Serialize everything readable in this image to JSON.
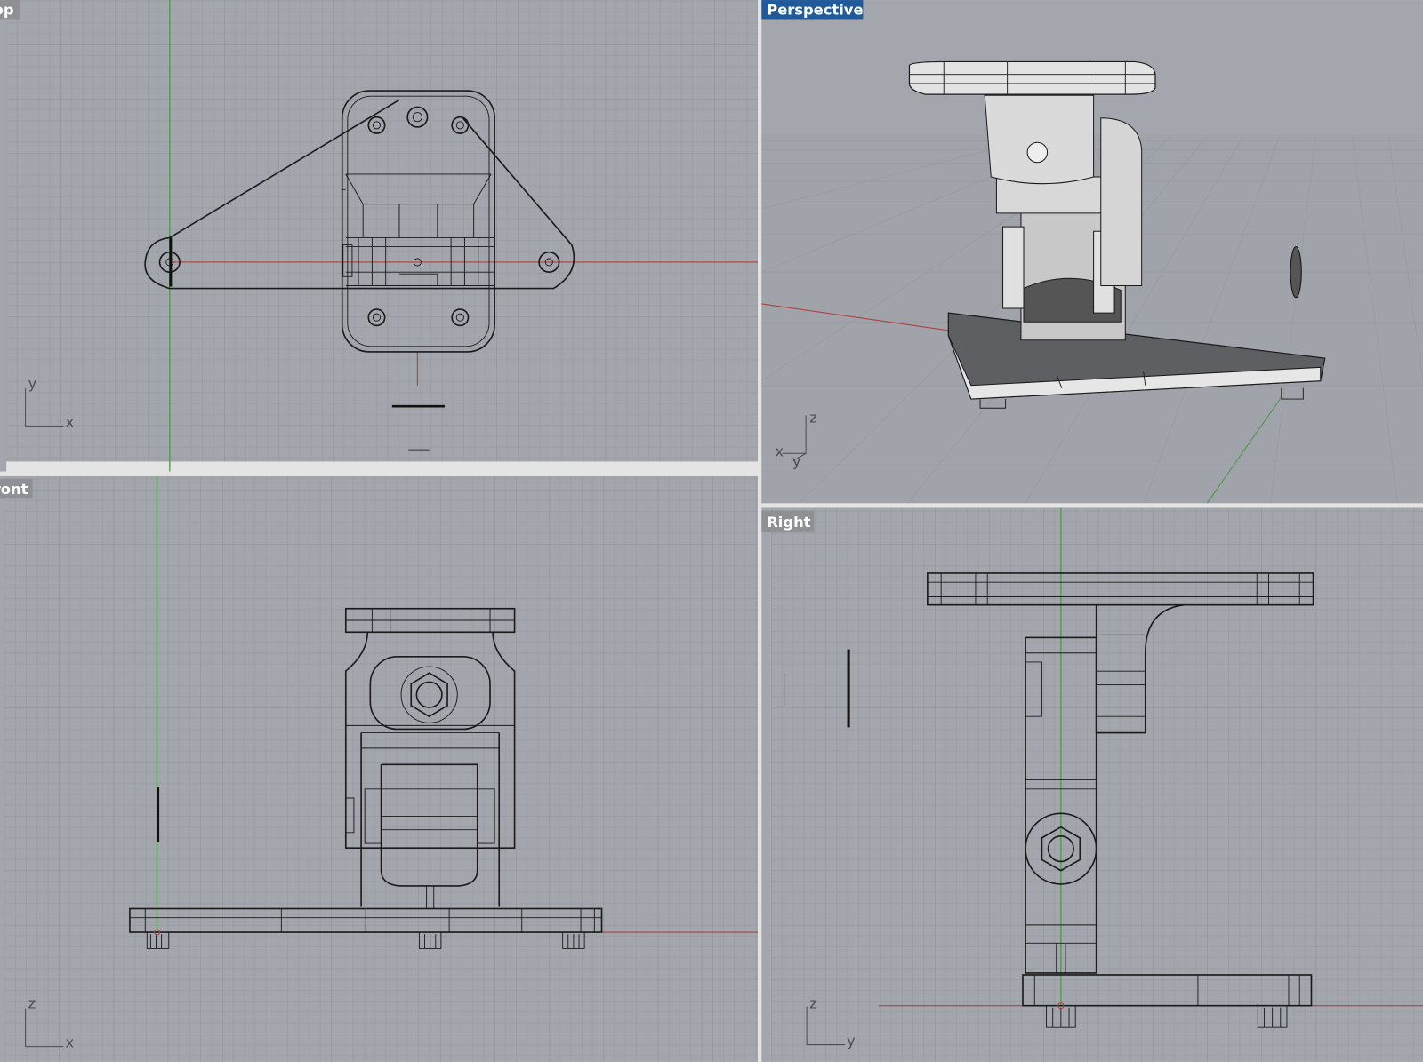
{
  "app": "Rhino 3D modeling viewports",
  "colors": {
    "viewport_bg": "#a3a6ac",
    "grid_minor": "#989ba1",
    "grid_major": "#8c8f95",
    "x_axis": "#b0423f",
    "y_axis": "#4f9a4a",
    "active_label_bg": "#1f5a9a",
    "inactive_label_bg": "#8e9094",
    "divider": "#e4e4e4"
  },
  "viewports": [
    {
      "id": "top",
      "label": "Top",
      "active": false,
      "axis_labels": [
        "y",
        "x"
      ]
    },
    {
      "id": "perspective",
      "label": "Perspective",
      "active": true,
      "axis_labels": [
        "z",
        "x",
        "y"
      ]
    },
    {
      "id": "front",
      "label": "Front",
      "active": false,
      "axis_labels": [
        "z",
        "x"
      ]
    },
    {
      "id": "right",
      "label": "Right",
      "active": false,
      "axis_labels": [
        "z",
        "y"
      ]
    }
  ]
}
